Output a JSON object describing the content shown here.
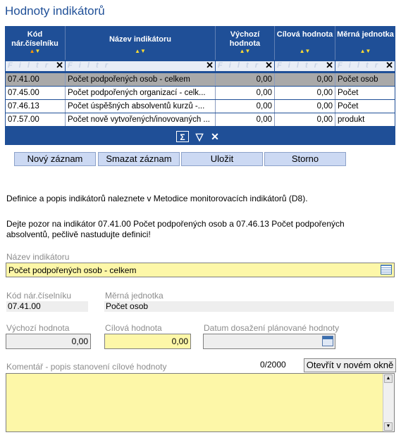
{
  "page_title": "Hodnoty indikátorů",
  "grid": {
    "columns": [
      "Kód nár.číselníku",
      "Název indikátoru",
      "Výchozí hodnota",
      "Cílová hodnota",
      "Měrná jednotka"
    ],
    "filter_placeholder": "F i l t r",
    "rows": [
      [
        "07.41.00",
        "Počet podpořených osob - celkem",
        "0,00",
        "0,00",
        "Počet osob"
      ],
      [
        "07.45.00",
        "Počet podpořených organizací - celk...",
        "0,00",
        "0,00",
        "Počet"
      ],
      [
        "07.46.13",
        "Počet úspěšných absolventů kurzů -...",
        "0,00",
        "0,00",
        "Počet"
      ],
      [
        "07.57.00",
        "Počet nově vytvořených/inovovaných ...",
        "0,00",
        "0,00",
        "produkt"
      ]
    ],
    "selected_row": 0
  },
  "buttons": {
    "new": "Nový záznam",
    "delete": "Smazat záznam",
    "save": "Uložit",
    "cancel": "Storno"
  },
  "info": {
    "line1": "Definice a popis indikátorů naleznete v Metodice monitorovacích indikátorů (D8).",
    "line2": "Dejte pozor na indikátor 07.41.00 Počet podpořených osob a 07.46.13 Počet podpořených",
    "line3": "absolventů, pečlivě nastudujte definici!"
  },
  "form": {
    "name_label": "Název indikátoru",
    "name_value": "Počet podpořených osob - celkem",
    "code_label": "Kód nár.číselníku",
    "code_value": "07.41.00",
    "unit_label": "Měrná jednotka",
    "unit_value": "Počet osob",
    "start_label": "Výchozí hodnota",
    "start_value": "0,00",
    "target_label": "Cílová hodnota",
    "target_value": "0,00",
    "date_label": "Datum dosažení plánované hodnoty",
    "date_value": "",
    "comment_label": "Komentář - popis stanovení cílové hodnoty",
    "comment_counter": "0/2000",
    "open_new_window": "Otevřít v novém okně",
    "comment_value": ""
  },
  "colors": {
    "accent": "#1f4f97",
    "highlight_field": "#fdf7a8",
    "selected_row": "#a9a9a9",
    "button": "#ccd9f3"
  }
}
